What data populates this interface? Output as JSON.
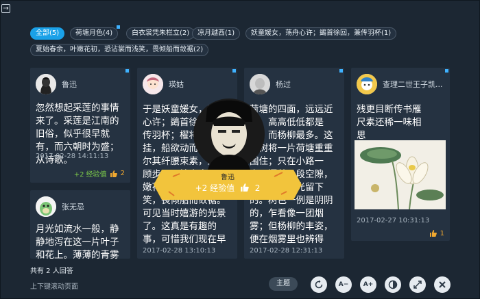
{
  "window": {
    "back_icon": "arrow-right-icon"
  },
  "tabs": [
    {
      "label": "全部(5)",
      "active": true
    },
    {
      "label": "荷塘月色(4)",
      "active": false
    },
    {
      "label": "白衣裳凭朱栏立(2)",
      "active": false
    },
    {
      "label": "凉月越西(1)",
      "active": false
    },
    {
      "label": "妖童媛女，荡舟心许；鷁首徐回，兼传羽杯(1)",
      "active": false
    },
    {
      "label": "夏始春余，叶嫩花初，恐沾裳而浅笑，畏倾船而敛裾(2)",
      "active": false
    }
  ],
  "cards": [
    {
      "user": "鲁迅",
      "text": "忽然想起采莲的事情来了。采莲是江南的旧俗，似乎很早就有，而六朝时为盛；从诗歌。",
      "date": "2017-02-28 14:11:13",
      "exp": "+2 经验值",
      "likes": "2"
    },
    {
      "user": "张无忌",
      "text": "月光如流水一般，静静地泻在这一片叶子和花上。薄薄的青雾浮起在"
    },
    {
      "user": "瑛姑",
      "text": "于是妖童媛女，荡舟心许；鷁首徐回，兼传羽杯；櫂将移而藻挂，船欲动而萍开。尔其纤腰束素，迁延顾步；夏始春余，叶嫩花初，恐沾裳而浅笑，畏倾船而敛裾。可见当时嬉游的光景了。这真是有趣的事，可惜我们现在早已无福消受了。这真是有趣的",
      "date": "2017-02-28 13:10:13"
    },
    {
      "user": "杨过",
      "text": "荷塘的四面，远远近近，高高低低都是树，而杨柳最多。这些树将一片荷塘重重围住；只在小路一旁，漏着几段空隙，像是特为月光留下的。树色一例是阴阴的，乍看像一团烟雾；但杨柳的丰姿，便在烟雾里也辨得出。树梢上隐隐约约的是一带远山，只有些大意罢了。",
      "date": "2017-02-28 12:31:13"
    },
    {
      "user": "查理二世王子凯...",
      "text": "残更目断传书雁尺素还稀一味相思",
      "date": "2017-02-27 10:31:13",
      "likes": "1"
    }
  ],
  "popup": {
    "user": "鲁迅",
    "exp": "+2 经验值",
    "likes": "2"
  },
  "footer": {
    "count_text": "共有 2 人回答",
    "hint": "上下键滚动页面",
    "theme_label": "主题",
    "controls": [
      {
        "name": "refresh-icon"
      },
      {
        "name": "font-decrease-icon",
        "label": "A−"
      },
      {
        "name": "font-increase-icon",
        "label": "A+"
      },
      {
        "name": "contrast-icon"
      },
      {
        "name": "fullscreen-icon"
      },
      {
        "name": "close-icon"
      }
    ]
  },
  "colors": {
    "accent": "#1aa1e8",
    "background": "#1c2733",
    "card": "#253241",
    "exp": "#7fcf4a",
    "like": "#f0a830",
    "ribbon": "#f2c43c"
  }
}
